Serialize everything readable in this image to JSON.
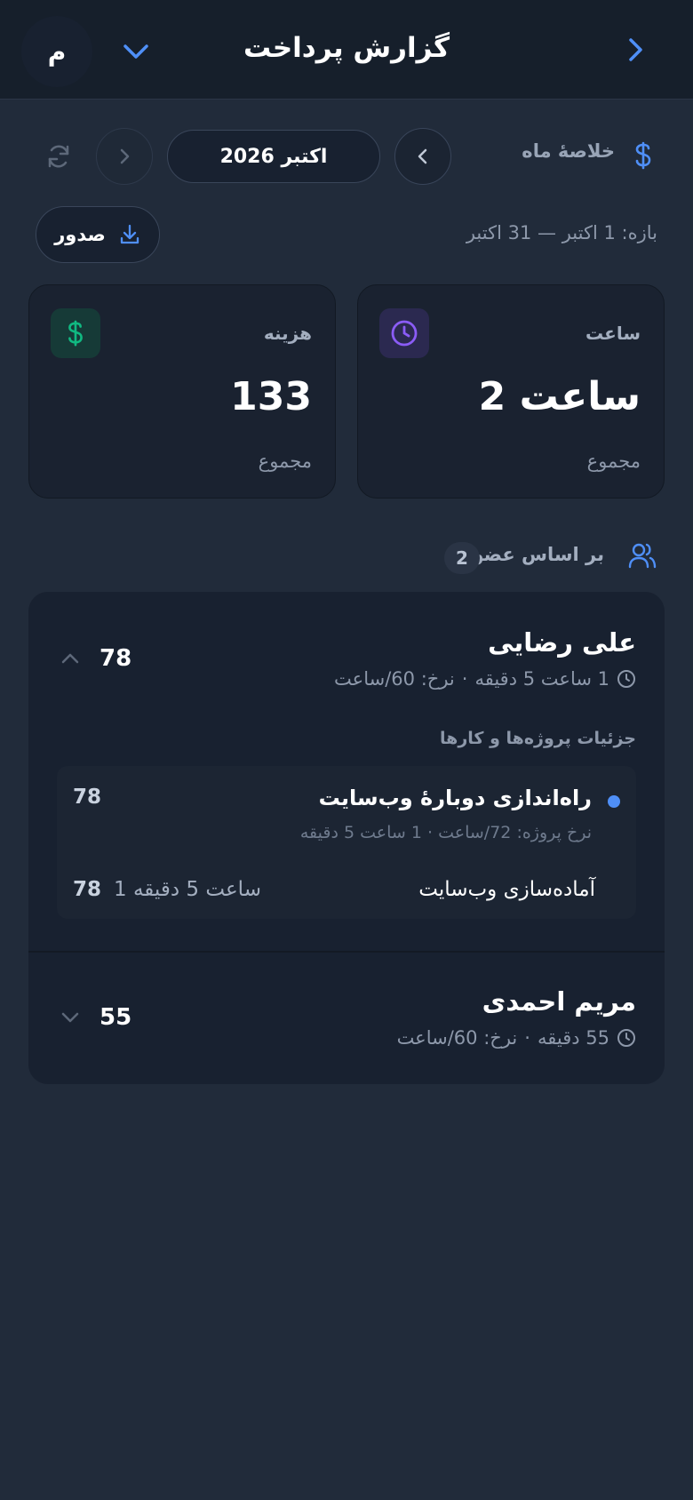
{
  "header": {
    "title": "گزارش پرداخت",
    "avatar_initial": "م"
  },
  "toolbar": {
    "summary_label": "خلاصهٔ ماه",
    "month_label": "اکتبر 2026",
    "export_label": "صدور",
    "range_text": "بازه: 1 اکتبر — 31 اکتبر"
  },
  "stats": [
    {
      "label": "ساعت",
      "value": "2 ساعت",
      "sub": "مجموع",
      "icon": "clock-icon",
      "color": "#8b5cf6"
    },
    {
      "label": "هزینه",
      "value": "133",
      "sub": "مجموع",
      "icon": "dollar-icon",
      "color": "#10b981"
    }
  ],
  "members": {
    "title": "بر اساس عضو",
    "count": "2",
    "details_title": "جزئیات پروژه‌ها و کارها",
    "items": [
      {
        "name": "علی رضایی",
        "duration": "1 ساعت 5 دقیقه",
        "rate": "نرخ: 60/ساعت",
        "amount": "78",
        "expanded": true,
        "project": {
          "name": "راه‌اندازی دوبارهٔ وب‌سایت",
          "amount": "78",
          "meta": "نرخ پروژه: 72/ساعت · 1 ساعت 5 دقیقه",
          "task": {
            "name": "آماده‌سازی وب‌سایت",
            "duration": "1 ساعت 5 دقیقه",
            "amount": "78"
          }
        }
      },
      {
        "name": "مریم احمدی",
        "duration": "55 دقیقه",
        "rate": "نرخ: 60/ساعت",
        "amount": "55",
        "expanded": false
      }
    ]
  },
  "colors": {
    "accent": "#4f8ff7",
    "purple": "#8b5cf6",
    "green": "#10b981"
  }
}
